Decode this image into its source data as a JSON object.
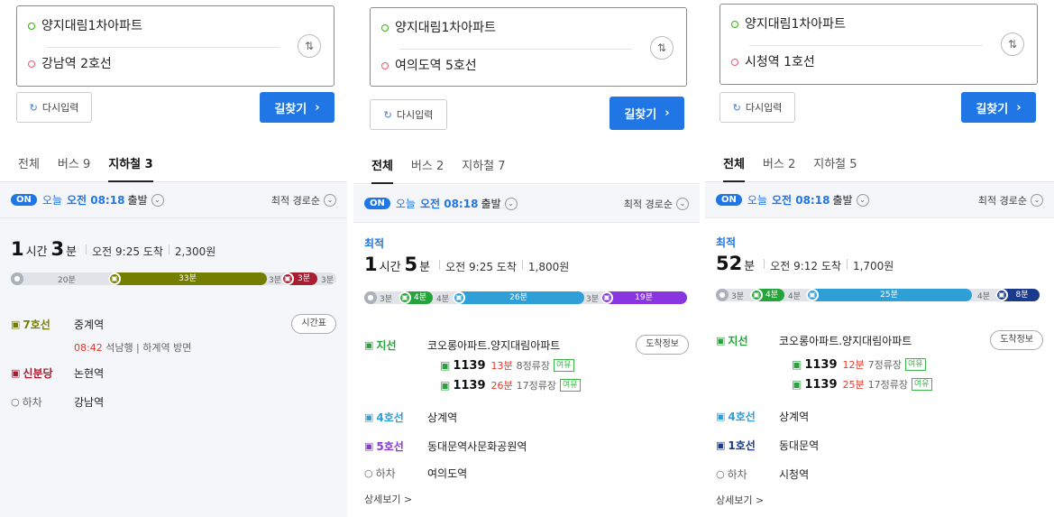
{
  "panels": [
    {
      "origin": "양지대림1차아파트",
      "destination": "강남역 2호선",
      "reset_label": "다시입력",
      "find_label": "길찾기",
      "tabs": [
        "전체",
        "버스 9",
        "지하철 3"
      ],
      "active_tab": 2,
      "on_label": "ON",
      "today_label": "오늘",
      "time_label": "오전 08:18",
      "depart_label": "출발",
      "sort_label": "최적 경로순",
      "best_label": "",
      "duration_big1": "1",
      "duration_unit1": "시간",
      "duration_big2": "3",
      "duration_unit2": "분",
      "arrival": "오전 9:25 도착",
      "fare": "2,300원",
      "timeline": [
        "20분",
        "33분",
        "3분",
        "3분",
        "3분"
      ],
      "steps": [
        {
          "label": "7호선",
          "place": "중계역",
          "color": "#747f00",
          "button": "시간표"
        },
        {
          "label": "신분당",
          "place": "논현역",
          "color": "#a71e31",
          "button": ""
        },
        {
          "label": "하차",
          "place": "강남역",
          "color": "#666666",
          "button": ""
        }
      ],
      "train_time": "08:42",
      "train_desc": "석남행 | 하계역 방면"
    },
    {
      "origin": "양지대림1차아파트",
      "destination": "여의도역 5호선",
      "reset_label": "다시입력",
      "find_label": "길찾기",
      "tabs": [
        "전체",
        "버스 2",
        "지하철 7"
      ],
      "active_tab": 0,
      "on_label": "ON",
      "today_label": "오늘",
      "time_label": "오전 08:18",
      "depart_label": "출발",
      "sort_label": "최적 경로순",
      "best_label": "최적",
      "duration_big1": "1",
      "duration_unit1": "시간",
      "duration_big2": "5",
      "duration_unit2": "분",
      "arrival": "오전 9:25 도착",
      "fare": "1,800원",
      "timeline": [
        "3분",
        "4분",
        "4분",
        "26분",
        "3분",
        "19분"
      ],
      "steps": [
        {
          "label": "지선",
          "place": "코오롱아파트.양지대림아파트",
          "color": "#25a43a",
          "button": "도착정보"
        },
        {
          "label": "4호선",
          "place": "상계역",
          "color": "#2f9fd8",
          "button": ""
        },
        {
          "label": "5호선",
          "place": "동대문역사문화공원역",
          "color": "#8936e0",
          "button": ""
        },
        {
          "label": "하차",
          "place": "여의도역",
          "color": "#666666",
          "button": ""
        }
      ],
      "buses": [
        {
          "no": "1139",
          "eta": "13분",
          "stops": "8정류장",
          "tag": "여유"
        },
        {
          "no": "1139",
          "eta": "26분",
          "stops": "17정류장",
          "tag": "여유"
        }
      ],
      "more_label": "상세보기 >"
    },
    {
      "origin": "양지대림1차아파트",
      "destination": "시청역 1호선",
      "reset_label": "다시입력",
      "find_label": "길찾기",
      "tabs": [
        "전체",
        "버스 2",
        "지하철 5"
      ],
      "active_tab": 0,
      "on_label": "ON",
      "today_label": "오늘",
      "time_label": "오전 08:18",
      "depart_label": "출발",
      "sort_label": "최적 경로순",
      "best_label": "최적",
      "duration_big1": "52",
      "duration_unit1": "분",
      "duration_big2": "",
      "duration_unit2": "",
      "arrival": "오전 9:12 도착",
      "fare": "1,700원",
      "timeline": [
        "3분",
        "4분",
        "4분",
        "25분",
        "4분",
        "8분"
      ],
      "steps": [
        {
          "label": "지선",
          "place": "코오롱아파트.양지대림아파트",
          "color": "#25a43a",
          "button": "도착정보"
        },
        {
          "label": "4호선",
          "place": "상계역",
          "color": "#2f9fd8",
          "button": ""
        },
        {
          "label": "1호선",
          "place": "동대문역",
          "color": "#1b3a8c",
          "button": ""
        },
        {
          "label": "하차",
          "place": "시청역",
          "color": "#666666",
          "button": ""
        }
      ],
      "buses": [
        {
          "no": "1139",
          "eta": "12분",
          "stops": "7정류장",
          "tag": "여유"
        },
        {
          "no": "1139",
          "eta": "25분",
          "stops": "17정류장",
          "tag": "여유"
        }
      ],
      "more_label": "상세보기 >"
    }
  ]
}
